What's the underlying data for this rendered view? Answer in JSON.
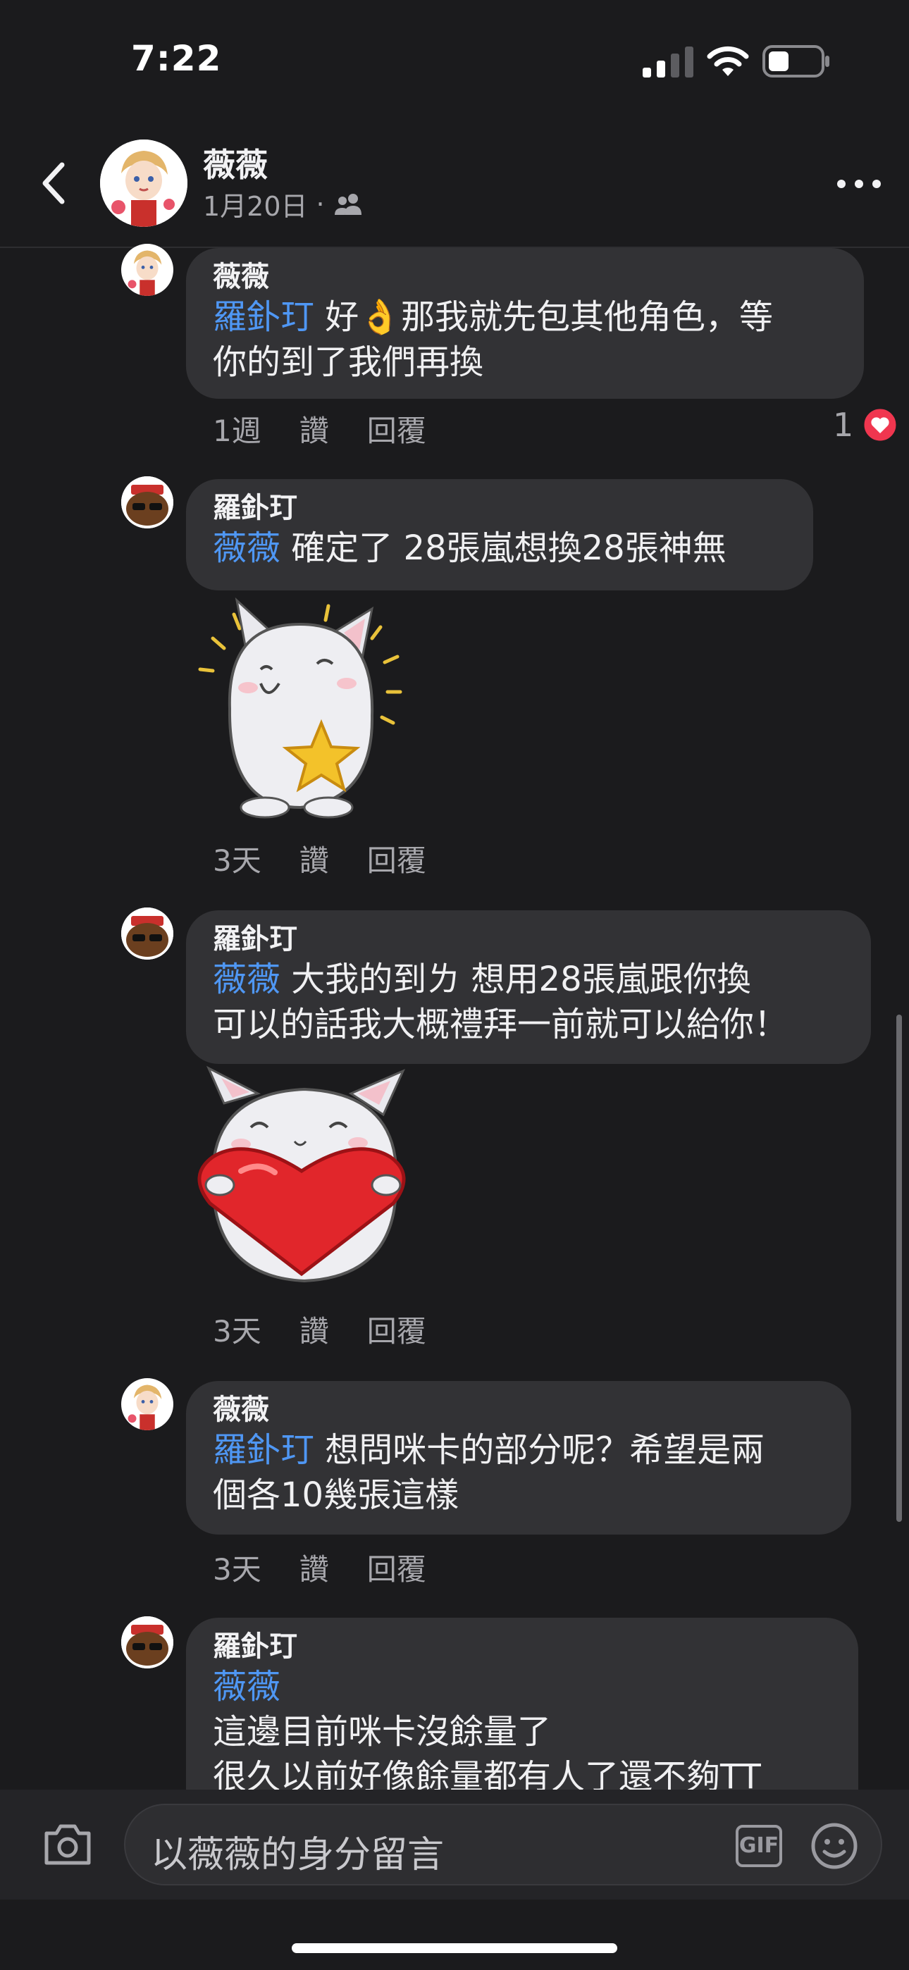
{
  "status_bar": {
    "time": "7:22"
  },
  "header": {
    "name": "薇薇",
    "date": "1月20日",
    "separator": "·"
  },
  "comments": [
    {
      "author": "薇薇",
      "mention": "羅釙玎",
      "lines": [
        " 好👌那我就先包其他角色，等",
        "你的到了我們再換"
      ],
      "time": "1週",
      "like": "讚",
      "reply": "回覆",
      "reaction_count": "1"
    },
    {
      "author": "羅釙玎",
      "mention": "薇薇",
      "lines": [
        " 確定了 28張嵐想換28張神無"
      ],
      "sticker": "star-bunny-sticker",
      "time": "3天",
      "like": "讚",
      "reply": "回覆"
    },
    {
      "author": "羅釙玎",
      "mention": "薇薇",
      "lines": [
        " 大我的到ㄌ 想用28張嵐跟你換",
        "可以的話我大概禮拜一前就可以給你！"
      ],
      "sticker": "heart-bunny-sticker",
      "time": "3天",
      "like": "讚",
      "reply": "回覆"
    },
    {
      "author": "薇薇",
      "mention": "羅釙玎",
      "lines": [
        " 想問咪卡的部分呢？希望是兩",
        "個各10幾張這樣"
      ],
      "time": "3天",
      "like": "讚",
      "reply": "回覆"
    },
    {
      "author": "羅釙玎",
      "mention": "薇薇",
      "lines": [
        "這邊目前咪卡沒餘量了",
        "很久以前好像餘量都有人了還不夠TT"
      ]
    }
  ],
  "composer": {
    "placeholder": "以薇薇的身分留言",
    "gif_label": "GIF"
  },
  "colors": {
    "background": "#1b1b1d",
    "bubble": "#323235",
    "mention": "#4f97f4",
    "heart": "#f0364f"
  }
}
